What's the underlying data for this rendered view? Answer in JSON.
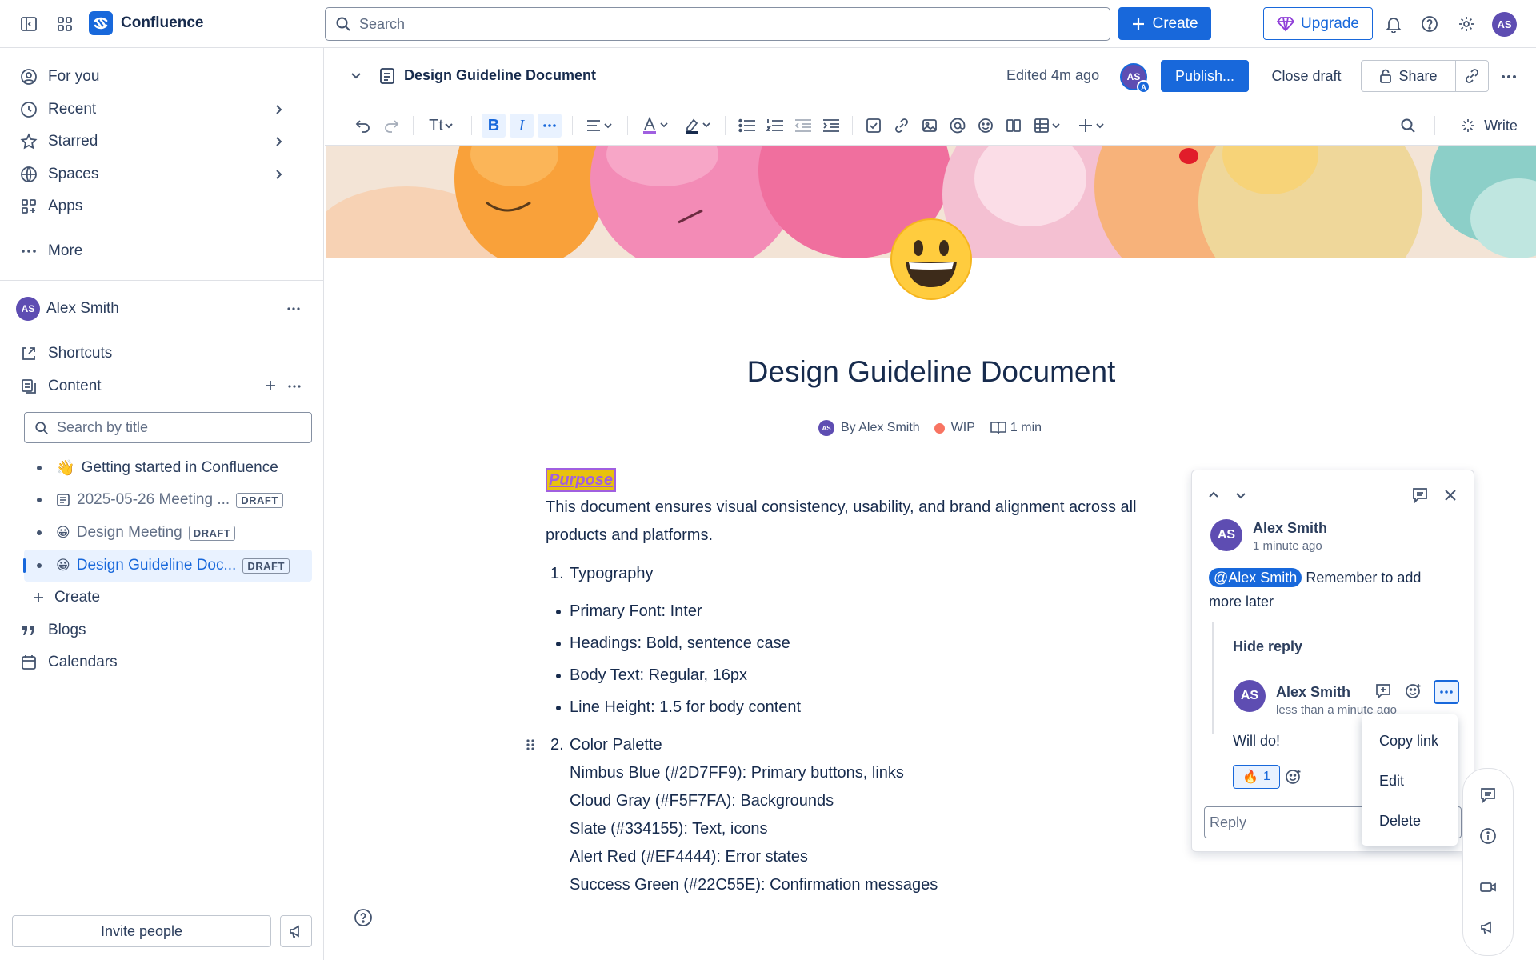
{
  "topbar": {
    "app_name": "Confluence",
    "search_placeholder": "Search",
    "create_label": "Create",
    "upgrade_label": "Upgrade",
    "user_initials": "AS"
  },
  "sidebar": {
    "nav": [
      {
        "label": "For you",
        "icon": "person-circle-icon"
      },
      {
        "label": "Recent",
        "icon": "clock-icon"
      },
      {
        "label": "Starred",
        "icon": "star-icon"
      },
      {
        "label": "Spaces",
        "icon": "globe-icon"
      },
      {
        "label": "Apps",
        "icon": "apps-icon"
      },
      {
        "label": "More",
        "icon": "more-icon"
      }
    ],
    "space_owner": "Alex Smith",
    "space_initials": "AS",
    "shortcuts_label": "Shortcuts",
    "content_label": "Content",
    "search_placeholder": "Search by title",
    "tree": [
      {
        "emoji": "👋",
        "title": "Getting started in Confluence",
        "draft": ""
      },
      {
        "emoji": "",
        "title": "2025-05-26 Meeting ...",
        "draft": "DRAFT"
      },
      {
        "emoji": "😀",
        "title": "Design Meeting",
        "draft": "DRAFT"
      },
      {
        "emoji": "😀",
        "title": "Design Guideline Doc...",
        "draft": "DRAFT"
      }
    ],
    "create_label": "Create",
    "blogs_label": "Blogs",
    "calendars_label": "Calendars",
    "invite_label": "Invite people"
  },
  "pagebar": {
    "title": "Design Guideline Document",
    "edited": "Edited 4m ago",
    "avatar_initials": "AS",
    "avatar_badge": "A",
    "publish_label": "Publish...",
    "close_draft_label": "Close draft",
    "share_label": "Share"
  },
  "toolbar": {
    "text_style": "Tt",
    "write_label": "Write"
  },
  "document": {
    "title": "Design Guideline Document",
    "byline_initials": "AS",
    "byline": "By Alex Smith",
    "status": "WIP",
    "read_time": "1 min",
    "purpose": "Purpose",
    "intro_1": "This document ensures visual consistency, usability, and brand alignment across all",
    "intro_2": "products and platforms.",
    "section1_num": "1.",
    "section1": "Typography",
    "typography": [
      "Primary Font: Inter",
      "Headings: Bold, sentence case",
      "Body Text: Regular, 16px",
      "Line Height: 1.5 for body content"
    ],
    "section2_num": "2.",
    "section2": "Color Palette",
    "colors": [
      "Nimbus Blue (#2D7FF9): Primary buttons, links",
      "Cloud Gray (#F5F7FA): Backgrounds",
      "Slate (#334155): Text, icons",
      "Alert Red (#EF4444): Error states",
      "Success Green (#22C55E): Confirmation messages"
    ]
  },
  "comment": {
    "author": "Alex Smith",
    "initials": "AS",
    "time": "1 minute ago",
    "mention": "@Alex Smith",
    "text_1": "Remember to add",
    "text_2": "more later",
    "hide_reply": "Hide reply",
    "reply_author": "Alex Smith",
    "reply_initials": "AS",
    "reply_time": "less than a minute ago",
    "reply_text": "Will do!",
    "reaction_emoji": "🔥",
    "reaction_count": "1",
    "reply_placeholder": "Reply"
  },
  "menu": {
    "items": [
      "Copy link",
      "Edit",
      "Delete"
    ]
  },
  "colors": {
    "brand": "#1868db",
    "avatar": "#5e4db2",
    "status_wip": "#f87462"
  }
}
